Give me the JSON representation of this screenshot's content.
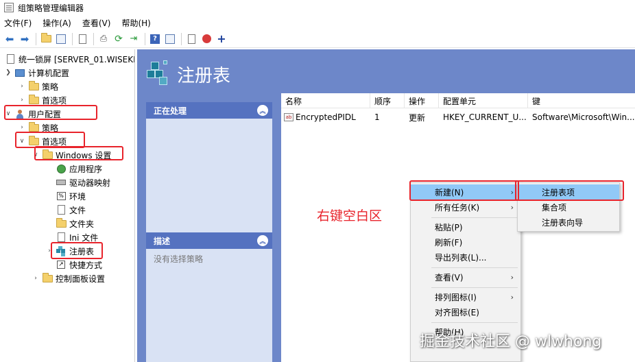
{
  "window": {
    "title": "组策略管理编辑器"
  },
  "menubar": [
    "文件(F)",
    "操作(A)",
    "查看(V)",
    "帮助(H)"
  ],
  "tree": {
    "root": "统一锁屏 [SERVER_01.WISEKI",
    "computer_config": "计算机配置",
    "computer_policies": "策略",
    "computer_preferences": "首选项",
    "user_config": "用户配置",
    "user_policies": "策略",
    "user_preferences": "首选项",
    "windows_settings": "Windows 设置",
    "applications": "应用程序",
    "drive_maps": "驱动器映射",
    "environment": "环境",
    "files": "文件",
    "folders": "文件夹",
    "ini_files": "Ini 文件",
    "registry": "注册表",
    "shortcuts": "快捷方式",
    "control_panel": "控制面板设置"
  },
  "main": {
    "title": "注册表",
    "processing_panel": {
      "title": "正在处理"
    },
    "description_panel": {
      "title": "描述",
      "text": "没有选择策略"
    },
    "columns": [
      "名称",
      "顺序",
      "操作",
      "配置单元",
      "键"
    ],
    "rows": [
      {
        "name": "EncryptedPIDL",
        "order": "1",
        "action": "更新",
        "hive": "HKEY_CURRENT_U...",
        "key": "Software\\Microsoft\\Win..."
      }
    ]
  },
  "annotation": "右键空白区",
  "context_menu": {
    "new": "新建(N)",
    "all_tasks": "所有任务(K)",
    "paste": "粘贴(P)",
    "refresh": "刷新(F)",
    "export_list": "导出列表(L)...",
    "view": "查看(V)",
    "arrange_icons": "排列图标(I)",
    "align_icons": "对齐图标(E)",
    "help": "帮助(H)"
  },
  "submenu": {
    "registry_item": "注册表项",
    "collection_item": "集合项",
    "registry_wizard": "注册表向导"
  },
  "watermark": "掘金技术社区 @ wlwhong",
  "colors": {
    "pane_blue": "#6d87c9",
    "highlight": "#91c9f7",
    "annotation_red": "#e8232b"
  }
}
